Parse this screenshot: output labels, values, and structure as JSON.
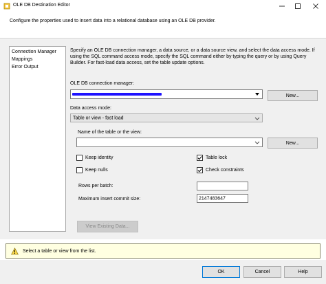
{
  "window": {
    "title": "OLE DB Destination Editor",
    "description": "Configure the properties used to insert data into a relational database using an OLE DB provider."
  },
  "nav": {
    "items": [
      {
        "label": "Connection Manager"
      },
      {
        "label": "Mappings"
      },
      {
        "label": "Error Output"
      }
    ]
  },
  "content": {
    "info": "Specify an OLE DB connection manager, a data source, or a data source view, and select the data access mode. If using the SQL command access mode, specify the SQL command either by typing the query or by using Query Builder. For fast-load data access, set the table update options.",
    "connection_manager_label": "OLE DB connection manager:",
    "connection_manager_value": "",
    "new_button_label": "New...",
    "data_access_mode_label": "Data access mode:",
    "data_access_mode_value": "Table or view - fast load",
    "table_name_label": "Name of the table or the view:",
    "table_name_value": "",
    "new_table_button_label": "New...",
    "options": {
      "keep_identity": {
        "label": "Keep identity",
        "checked": false
      },
      "keep_nulls": {
        "label": "Keep nulls",
        "checked": false
      },
      "table_lock": {
        "label": "Table lock",
        "checked": true
      },
      "check_constraints": {
        "label": "Check constraints",
        "checked": true
      }
    },
    "rows_per_batch_label": "Rows per batch:",
    "rows_per_batch_value": "",
    "max_insert_commit_label": "Maximum insert commit size:",
    "max_insert_commit_value": "2147483647",
    "view_existing_data_label": "View Existing Data..."
  },
  "status": {
    "message": "Select a table or view from the list."
  },
  "footer": {
    "ok_label": "OK",
    "cancel_label": "Cancel",
    "help_label": "Help"
  },
  "colors": {
    "redaction": "#1e12ff",
    "status_background": "#ffffe1",
    "ok_border": "#0078d7"
  }
}
